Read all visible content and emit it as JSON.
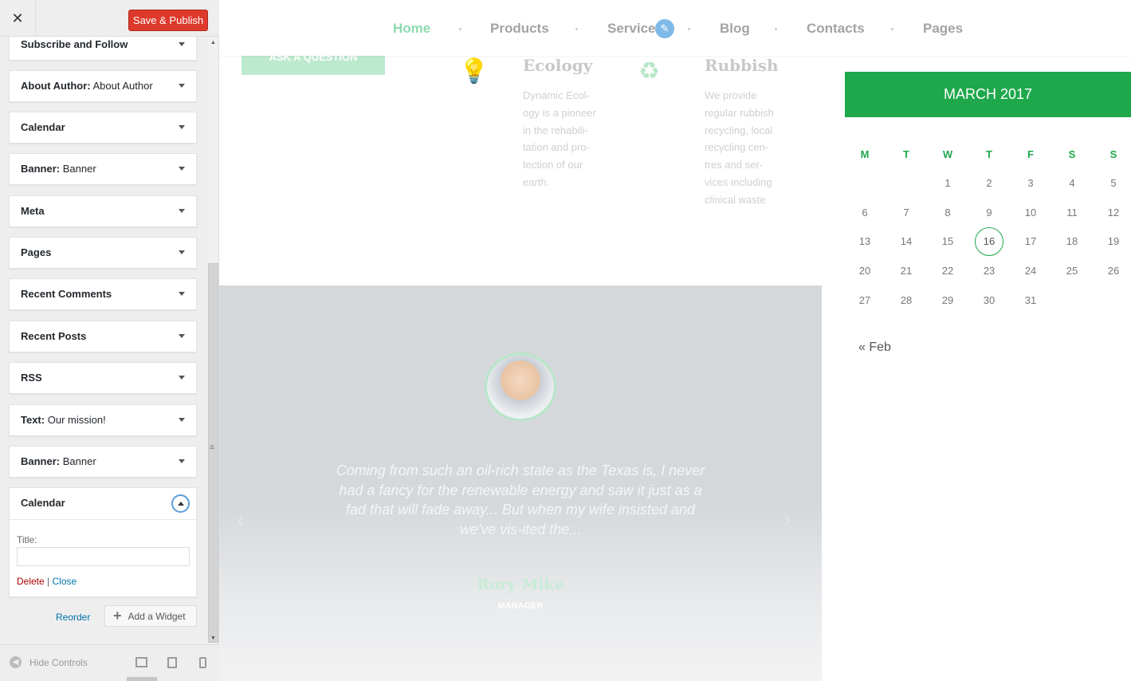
{
  "sidebar": {
    "close_label": "✕",
    "publish_label": "Save & Publish",
    "widgets": [
      {
        "name": "Subscribe and Follow",
        "sub": ""
      },
      {
        "name": "About Author:",
        "sub": "About Author"
      },
      {
        "name": "Calendar",
        "sub": ""
      },
      {
        "name": "Banner:",
        "sub": "Banner"
      },
      {
        "name": "Meta",
        "sub": ""
      },
      {
        "name": "Pages",
        "sub": ""
      },
      {
        "name": "Recent Comments",
        "sub": ""
      },
      {
        "name": "Recent Posts",
        "sub": ""
      },
      {
        "name": "RSS",
        "sub": ""
      },
      {
        "name": "Text:",
        "sub": "Our mission!"
      },
      {
        "name": "Banner:",
        "sub": "Banner"
      }
    ],
    "open_widget": {
      "name": "Calendar",
      "title_label": "Title:",
      "title_value": "",
      "delete_label": "Delete",
      "separator": "|",
      "close_label": "Close"
    },
    "reorder_label": "Reorder",
    "add_widget_label": "Add a Widget",
    "hide_controls_label": "Hide Controls"
  },
  "preview": {
    "nav": [
      "Home",
      "Products",
      "Service",
      "Blog",
      "Contacts",
      "Pages"
    ],
    "active_nav": "Home",
    "ask_button": "ASK A QUESTION",
    "services": [
      {
        "title": "Ecology",
        "icon": "lightbulb-icon",
        "lines": [
          "Dynamic Ecol-",
          "ogy is a pioneer",
          "in the rehabili-",
          "tation and pro-",
          "tection of our",
          "earth."
        ]
      },
      {
        "title": "Rubbish",
        "icon": "recycle-bin-icon",
        "lines": [
          "We provide",
          "regular rubbish",
          "recycling, local",
          "recycling cen-",
          "tres and ser-",
          "vices including",
          "clinical waste"
        ]
      }
    ],
    "testimonial": {
      "quote": "Coming from such an oil-rich state as the Texas is, I never had a fancy for the renewable energy and saw it just as a fad that will fade away... But when my wife insisted and we've vis-ited the...",
      "name": "Rory Mike",
      "role": "MANAGER"
    },
    "calendar": {
      "month_label": "MARCH 2017",
      "dow": [
        "M",
        "T",
        "W",
        "T",
        "F",
        "S",
        "S"
      ],
      "weeks": [
        [
          "",
          "",
          "1",
          "2",
          "3",
          "4",
          "5"
        ],
        [
          "6",
          "7",
          "8",
          "9",
          "10",
          "11",
          "12"
        ],
        [
          "13",
          "14",
          "15",
          "16",
          "17",
          "18",
          "19"
        ],
        [
          "20",
          "21",
          "22",
          "23",
          "24",
          "25",
          "26"
        ],
        [
          "27",
          "28",
          "29",
          "30",
          "31",
          "",
          ""
        ]
      ],
      "today": "16",
      "prev_link": "« Feb"
    },
    "colors": {
      "accent_green": "#1ea84b",
      "publish_red": "#dd3a2c",
      "link_blue": "#0073aa"
    }
  }
}
